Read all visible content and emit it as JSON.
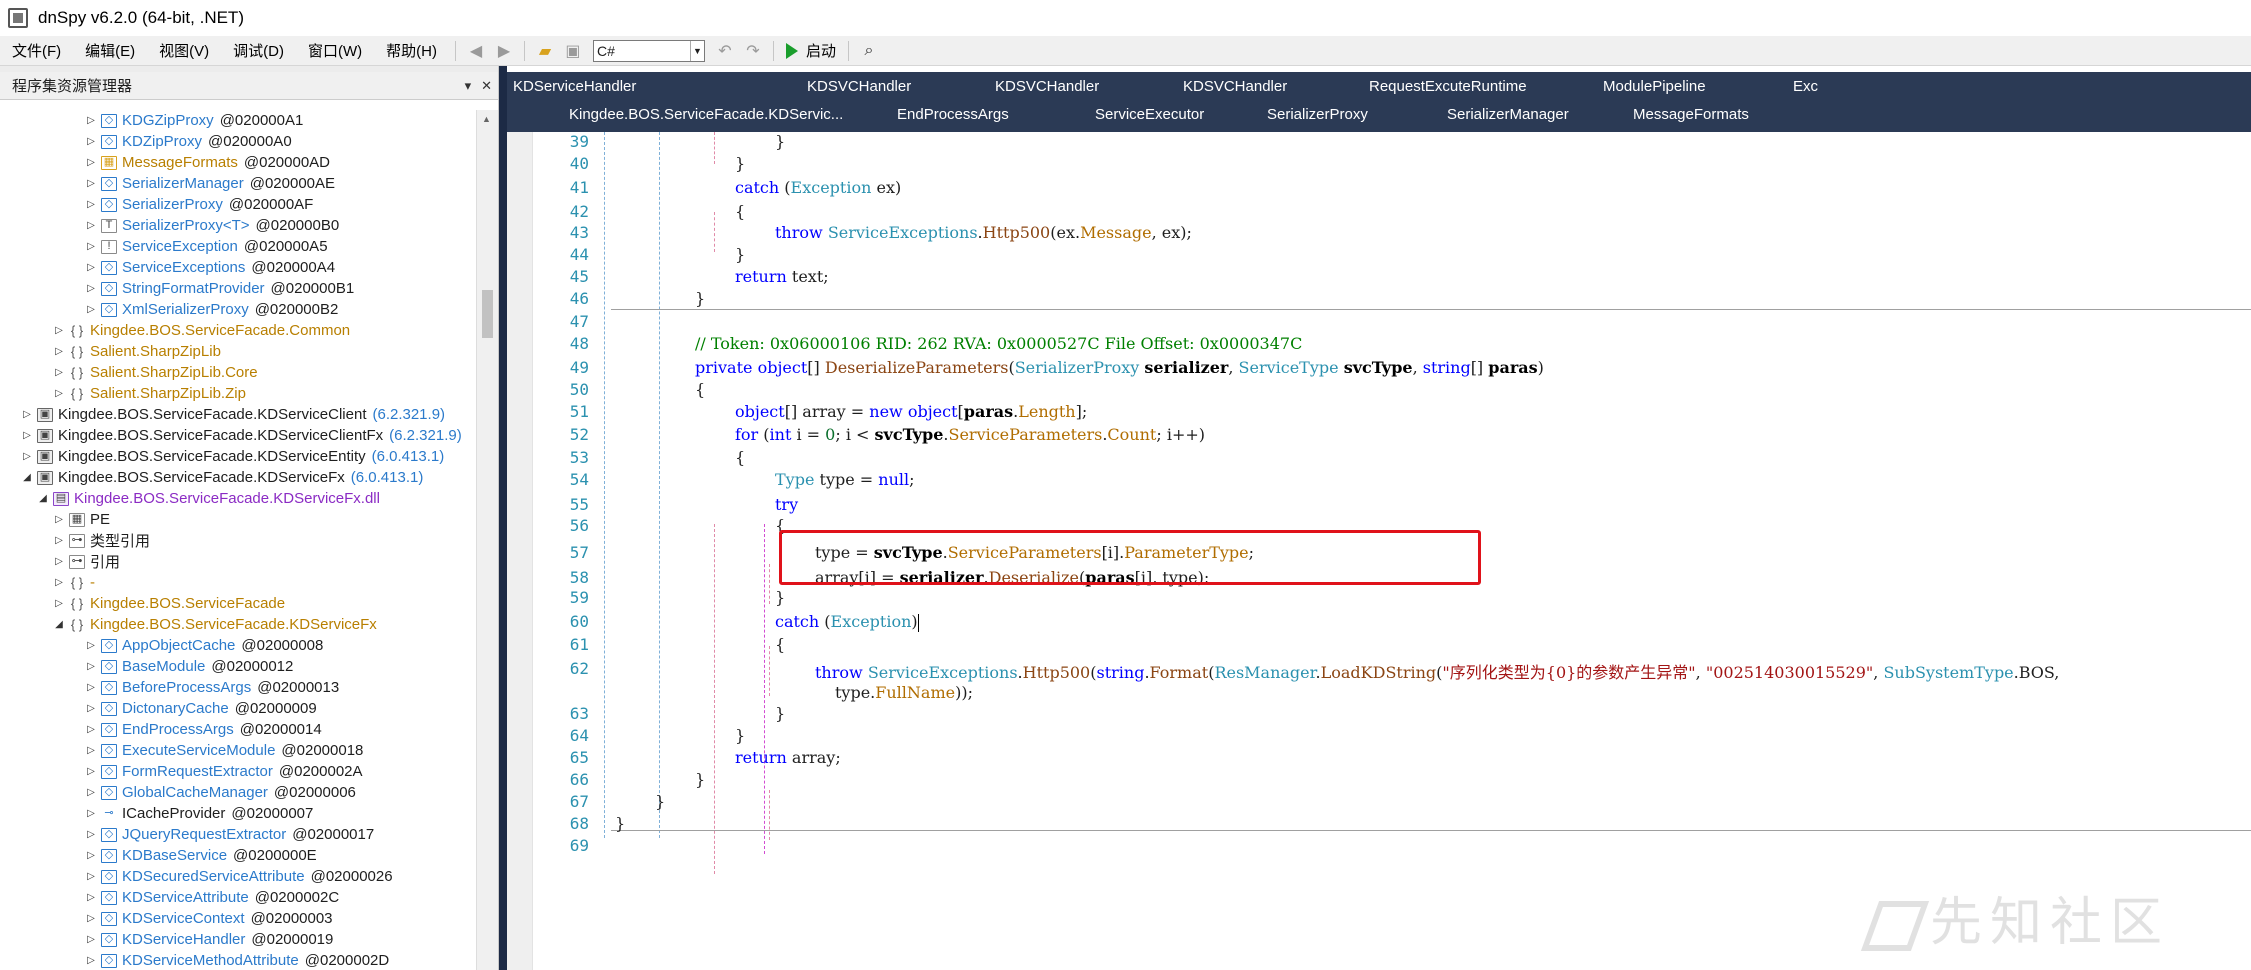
{
  "window": {
    "title": "dnSpy v6.2.0 (64-bit, .NET)"
  },
  "menu": [
    {
      "label": "文件(F)"
    },
    {
      "label": "编辑(E)"
    },
    {
      "label": "视图(V)"
    },
    {
      "label": "调试(D)"
    },
    {
      "label": "窗口(W)"
    },
    {
      "label": "帮助(H)"
    }
  ],
  "toolbar": {
    "language": "C#",
    "start_label": "启动"
  },
  "assembly_explorer": {
    "title": "程序集资源管理器",
    "rows": [
      {
        "indent": 5,
        "twisty": "▷",
        "icon": "class",
        "name": "KDGZipProxy",
        "token": "@020000A1",
        "kind": "class"
      },
      {
        "indent": 5,
        "twisty": "▷",
        "icon": "class",
        "name": "KDZipProxy",
        "token": "@020000A0",
        "kind": "class"
      },
      {
        "indent": 5,
        "twisty": "▷",
        "icon": "enum",
        "name": "MessageFormats",
        "token": "@020000AD",
        "kind": "ns"
      },
      {
        "indent": 5,
        "twisty": "▷",
        "icon": "class",
        "name": "SerializerManager",
        "token": "@020000AE",
        "kind": "class"
      },
      {
        "indent": 5,
        "twisty": "▷",
        "icon": "class",
        "name": "SerializerProxy",
        "token": "@020000AF",
        "kind": "class"
      },
      {
        "indent": 5,
        "twisty": "▷",
        "icon": "generic",
        "name": "SerializerProxy<T>",
        "token": "@020000B0",
        "kind": "class"
      },
      {
        "indent": 5,
        "twisty": "▷",
        "icon": "exception",
        "name": "ServiceException",
        "token": "@020000A5",
        "kind": "class"
      },
      {
        "indent": 5,
        "twisty": "▷",
        "icon": "class",
        "name": "ServiceExceptions",
        "token": "@020000A4",
        "kind": "class"
      },
      {
        "indent": 5,
        "twisty": "▷",
        "icon": "class",
        "name": "StringFormatProvider",
        "token": "@020000B1",
        "kind": "class"
      },
      {
        "indent": 5,
        "twisty": "▷",
        "icon": "class",
        "name": "XmlSerializerProxy",
        "token": "@020000B2",
        "kind": "class"
      },
      {
        "indent": 3,
        "twisty": "▷",
        "icon": "namespace",
        "name": "Kingdee.BOS.ServiceFacade.Common",
        "token": "",
        "kind": "ns"
      },
      {
        "indent": 3,
        "twisty": "▷",
        "icon": "namespace",
        "name": "Salient.SharpZipLib",
        "token": "",
        "kind": "ns"
      },
      {
        "indent": 3,
        "twisty": "▷",
        "icon": "namespace",
        "name": "Salient.SharpZipLib.Core",
        "token": "",
        "kind": "ns"
      },
      {
        "indent": 3,
        "twisty": "▷",
        "icon": "namespace",
        "name": "Salient.SharpZipLib.Zip",
        "token": "",
        "kind": "ns"
      },
      {
        "indent": 1,
        "twisty": "▷",
        "icon": "assembly",
        "name": "Kingdee.BOS.ServiceFacade.KDServiceClient",
        "version": "(6.2.321.9)",
        "kind": "asm"
      },
      {
        "indent": 1,
        "twisty": "▷",
        "icon": "assembly",
        "name": "Kingdee.BOS.ServiceFacade.KDServiceClientFx",
        "version": "(6.2.321.9)",
        "kind": "asm"
      },
      {
        "indent": 1,
        "twisty": "▷",
        "icon": "assembly",
        "name": "Kingdee.BOS.ServiceFacade.KDServiceEntity",
        "version": "(6.0.413.1)",
        "kind": "asm"
      },
      {
        "indent": 1,
        "twisty": "◢",
        "icon": "assembly",
        "name": "Kingdee.BOS.ServiceFacade.KDServiceFx",
        "version": "(6.0.413.1)",
        "kind": "asm"
      },
      {
        "indent": 2,
        "twisty": "◢",
        "icon": "dll",
        "name": "Kingdee.BOS.ServiceFacade.KDServiceFx.dll",
        "token": "",
        "kind": "dll"
      },
      {
        "indent": 3,
        "twisty": "▷",
        "icon": "pe",
        "name": "PE",
        "token": "",
        "kind": "plain"
      },
      {
        "indent": 3,
        "twisty": "▷",
        "icon": "ref",
        "name": "类型引用",
        "token": "",
        "kind": "plain"
      },
      {
        "indent": 3,
        "twisty": "▷",
        "icon": "ref",
        "name": "引用",
        "token": "",
        "kind": "plain"
      },
      {
        "indent": 3,
        "twisty": "▷",
        "icon": "namespace",
        "name": "-",
        "token": "",
        "kind": "ns"
      },
      {
        "indent": 3,
        "twisty": "▷",
        "icon": "namespace",
        "name": "Kingdee.BOS.ServiceFacade",
        "token": "",
        "kind": "ns"
      },
      {
        "indent": 3,
        "twisty": "◢",
        "icon": "namespace",
        "name": "Kingdee.BOS.ServiceFacade.KDServiceFx",
        "token": "",
        "kind": "ns"
      },
      {
        "indent": 5,
        "twisty": "▷",
        "icon": "class",
        "name": "AppObjectCache",
        "token": "@02000008",
        "kind": "class"
      },
      {
        "indent": 5,
        "twisty": "▷",
        "icon": "class",
        "name": "BaseModule",
        "token": "@02000012",
        "kind": "class"
      },
      {
        "indent": 5,
        "twisty": "▷",
        "icon": "class",
        "name": "BeforeProcessArgs",
        "token": "@02000013",
        "kind": "class"
      },
      {
        "indent": 5,
        "twisty": "▷",
        "icon": "class",
        "name": "DictonaryCache",
        "token": "@02000009",
        "kind": "class"
      },
      {
        "indent": 5,
        "twisty": "▷",
        "icon": "class",
        "name": "EndProcessArgs",
        "token": "@02000014",
        "kind": "class"
      },
      {
        "indent": 5,
        "twisty": "▷",
        "icon": "class",
        "name": "ExecuteServiceModule",
        "token": "@02000018",
        "kind": "class"
      },
      {
        "indent": 5,
        "twisty": "▷",
        "icon": "class",
        "name": "FormRequestExtractor",
        "token": "@0200002A",
        "kind": "class"
      },
      {
        "indent": 5,
        "twisty": "▷",
        "icon": "class",
        "name": "GlobalCacheManager",
        "token": "@02000006",
        "kind": "class"
      },
      {
        "indent": 5,
        "twisty": "▷",
        "icon": "interface",
        "name": "ICacheProvider",
        "token": "@02000007",
        "kind": "iface"
      },
      {
        "indent": 5,
        "twisty": "▷",
        "icon": "class",
        "name": "JQueryRequestExtractor",
        "token": "@02000017",
        "kind": "class"
      },
      {
        "indent": 5,
        "twisty": "▷",
        "icon": "class",
        "name": "KDBaseService",
        "token": "@0200000E",
        "kind": "class"
      },
      {
        "indent": 5,
        "twisty": "▷",
        "icon": "class",
        "name": "KDSecuredServiceAttribute",
        "token": "@02000026",
        "kind": "class"
      },
      {
        "indent": 5,
        "twisty": "▷",
        "icon": "class",
        "name": "KDServiceAttribute",
        "token": "@0200002C",
        "kind": "class"
      },
      {
        "indent": 5,
        "twisty": "▷",
        "icon": "class",
        "name": "KDServiceContext",
        "token": "@02000003",
        "kind": "class"
      },
      {
        "indent": 5,
        "twisty": "▷",
        "icon": "class",
        "name": "KDServiceHandler",
        "token": "@02000019",
        "kind": "class"
      },
      {
        "indent": 5,
        "twisty": "▷",
        "icon": "class",
        "name": "KDServiceMethodAttribute",
        "token": "@0200002D",
        "kind": "class"
      }
    ]
  },
  "tabs": {
    "row1": [
      "KDServiceHandler",
      "KDSVCHandler",
      "KDSVCHandler",
      "KDSVCHandler",
      "RequestExcuteRuntime",
      "ModulePipeline",
      "Exc"
    ],
    "row2": [
      "Kingdee.BOS.ServiceFacade.KDServic...",
      "EndProcessArgs",
      "ServiceExecutor",
      "SerializerProxy",
      "SerializerManager",
      "MessageFormats"
    ]
  },
  "editor": {
    "line_numbers": [
      "39",
      "40",
      "41",
      "42",
      "43",
      "44",
      "45",
      "46",
      "47",
      "48",
      "49",
      "50",
      "51",
      "52",
      "53",
      "54",
      "55",
      "56",
      "57",
      "58",
      "59",
      "60",
      "61",
      "62",
      "63",
      "64",
      "65",
      "66",
      "67",
      "68",
      "69"
    ],
    "code": {
      "l39": "}",
      "l40": "}",
      "l41_kw": "catch",
      "l41_type": "Exception",
      "l41_rest": " ex)",
      "l42": "{",
      "l43_kw": "throw",
      "l43_type": "ServiceExceptions",
      "l43_m": "Http500",
      "l43_a": "(ex.",
      "l43_mem": "Message",
      "l43_b": ", ex);",
      "l44": "}",
      "l45_kw": "return",
      "l45_rest": " text;",
      "l46": "}",
      "l48_comment": "// Token: 0x06000106 RID: 262 RVA: 0x0000527C File Offset: 0x0000347C",
      "l49_kw1": "private",
      "l49_kw2": "object",
      "l49_a": "[] ",
      "l49_m": "DeserializeParameters",
      "l49_b": "(",
      "l49_t1": "SerializerProxy",
      "l49_p1": "serializer",
      "l49_t2": "ServiceType",
      "l49_p2": "svcType",
      "l49_kw3": "string",
      "l49_c": "[] ",
      "l49_p3": "paras",
      "l49_d": ")",
      "l50": "{",
      "l51_kw1": "object",
      "l51_a": "[] array = ",
      "l51_kw2": "new",
      "l51_kw3": "object",
      "l51_b": "[",
      "l51_p": "paras",
      "l51_c": ".",
      "l51_mem": "Length",
      "l51_d": "];",
      "l52_kw1": "for",
      "l52_a": " (",
      "l52_kw2": "int",
      "l52_b": " i = ",
      "l52_num": "0",
      "l52_c": "; i < ",
      "l52_p": "svcType",
      "l52_d": ".",
      "l52_mem1": "ServiceParameters",
      "l52_e": ".",
      "l52_mem2": "Count",
      "l52_f": "; i++)",
      "l53": "{",
      "l54_type": "Type",
      "l54_a": " type = ",
      "l54_kw": "null",
      "l54_b": ";",
      "l55_kw": "try",
      "l56": "{",
      "l57_a": "type = ",
      "l57_p": "svcType",
      "l57_b": ".",
      "l57_mem1": "ServiceParameters",
      "l57_c": "[i].",
      "l57_mem2": "ParameterType",
      "l57_d": ";",
      "l58_a": "array[i] = ",
      "l58_p": "serializer",
      "l58_b": ".",
      "l58_m": "Deserialize",
      "l58_c": "(",
      "l58_p2": "paras",
      "l58_d": "[i], type);",
      "l59": "}",
      "l60_kw": "catch",
      "l60_a": " (",
      "l60_type": "Exception",
      "l60_b": ")",
      "l61": "{",
      "l62_kw": "throw",
      "l62_type": "ServiceExceptions",
      "l62_a": ".",
      "l62_m": "Http500",
      "l62_b": "(",
      "l62_kw2": "string",
      "l62_c": ".",
      "l62_m2": "Format",
      "l62_d": "(",
      "l62_type2": "ResManager",
      "l62_e": ".",
      "l62_m3": "LoadKDString",
      "l62_f": "(",
      "l62_str1": "\"序列化类型为{0}的参数产生异常\"",
      "l62_g": ", ",
      "l62_str2": "\"002514030015529\"",
      "l62_h": ", ",
      "l62_type3": "SubSystemType",
      "l62_i": ".BOS, ",
      "l62_cont": "type.",
      "l62_mem": "FullName",
      "l62_end": "));",
      "l63": "}",
      "l64": "}",
      "l65_kw": "return",
      "l65_rest": " array;",
      "l66": "}",
      "l67": "}",
      "l68": "}"
    }
  },
  "watermark": {
    "text": "先知社区"
  },
  "colors": {
    "tab_bg": "#2b3a55",
    "splitter": "#1c2a45",
    "highlight": "#e0121a",
    "keyword": "#0000ff",
    "type": "#2b91af"
  }
}
